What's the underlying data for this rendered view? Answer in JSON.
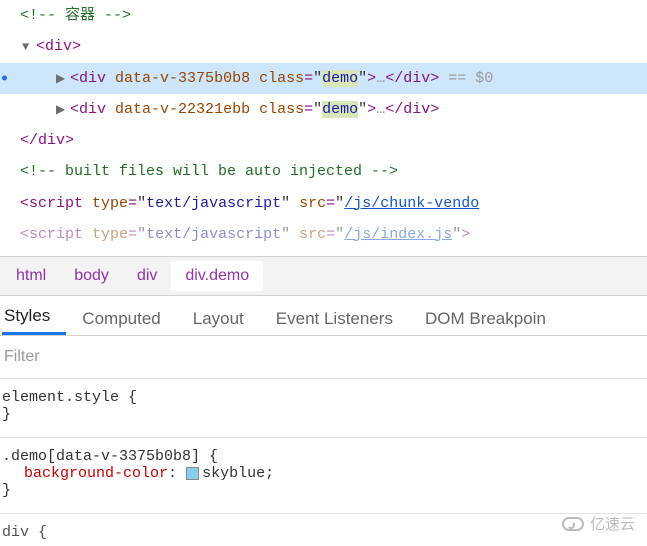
{
  "dom": {
    "comment1": "<!-- 容器 -->",
    "open_div": "div",
    "row_selected": {
      "tag": "div",
      "attr1_name": "data-v-3375b0b8",
      "attr_class_name": "class",
      "attr_class_value": "demo",
      "eq0": "== $0"
    },
    "row2": {
      "tag": "div",
      "attr1_name": "data-v-22321ebb",
      "attr_class_name": "class",
      "attr_class_value": "demo"
    },
    "close_div": "div",
    "comment2": "<!-- built files will be auto injected -->",
    "script1": {
      "tag": "script",
      "type_name": "type",
      "type_value": "text/javascript",
      "src_name": "src",
      "src_value": "/js/chunk-vendo"
    },
    "script2": {
      "tag": "script",
      "type_name": "type",
      "type_value": "text/javascript",
      "src_name": "src",
      "src_value": "/js/index.js"
    }
  },
  "breadcrumb": {
    "c0": "html",
    "c1": "body",
    "c2": "div",
    "c3": "div.demo"
  },
  "tabs": {
    "t0": "Styles",
    "t1": "Computed",
    "t2": "Layout",
    "t3": "Event Listeners",
    "t4": "DOM Breakpoin"
  },
  "filter_placeholder": "Filter",
  "styles": {
    "rule1_selector": "element.style {",
    "rule1_close": "}",
    "rule2_selector": ".demo[data-v-3375b0b8] {",
    "rule2_prop_name": "background-color",
    "rule2_prop_value": "skyblue",
    "rule2_close": "}"
  },
  "div_cut": "div {",
  "watermark": "亿速云"
}
